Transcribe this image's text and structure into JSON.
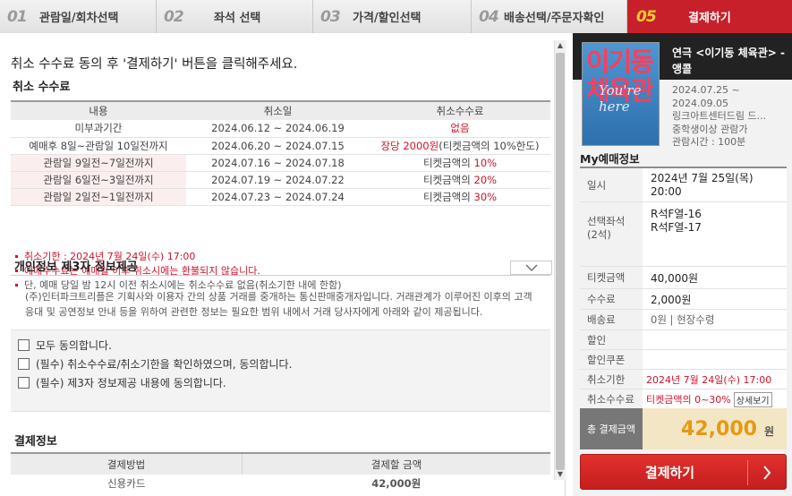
{
  "steps": [
    {
      "num": "01",
      "label": "관람일/회차선택"
    },
    {
      "num": "02",
      "label": "좌석 선택"
    },
    {
      "num": "03",
      "label": "가격/할인선택"
    },
    {
      "num": "04",
      "label": "배송선택/주문자확인"
    },
    {
      "num": "05",
      "label": "결제하기"
    }
  ],
  "instruction": "취소 수수료 동의 후 '결제하기' 버튼을 클릭해주세요.",
  "cancel_fee": {
    "title": "취소 수수료",
    "headers": [
      "내용",
      "취소일",
      "취소수수료"
    ],
    "rows": [
      {
        "content": "미부과기간",
        "date": "2024.06.12 ~ 2024.06.19",
        "fee_red": "없음",
        "fee_rest": ""
      },
      {
        "content": "예매후 8일~관람일 10일전까지",
        "date": "2024.06.20 ~ 2024.07.15",
        "fee_red": "장당 2000원",
        "fee_rest": "(티켓금액의 10%한도)"
      },
      {
        "content": "관람일 9일전~7일전까지",
        "date": "2024.07.16 ~ 2024.07.18",
        "fee_prefix": "티켓금액의 ",
        "fee_red": "10%"
      },
      {
        "content": "관람일 6일전~3일전까지",
        "date": "2024.07.19 ~ 2024.07.22",
        "fee_prefix": "티켓금액의 ",
        "fee_red": "20%"
      },
      {
        "content": "관람일 2일전~1일전까지",
        "date": "2024.07.23 ~ 2024.07.24",
        "fee_prefix": "티켓금액의 ",
        "fee_red": "30%"
      }
    ],
    "notes": [
      "취소기한 : 2024년 7월 24일(수) 17:00",
      "예매수수료는 예매일 이후 취소시에는 환불되지 않습니다.",
      "단, 예매 당일 밤 12시 이전 취소시에는 취소수수료 없음(취소기한 내에 한함)"
    ]
  },
  "privacy": {
    "title": "개인정보 제3자 정보제공",
    "text": "(주)인터파크트리플은 기획사와 이용자 간의 상품 거래를 중개하는 통신판매중개자입니다. 거래관계가 이루어진 이후의 고객응대 및 공연정보 안내 등을 위하여 관련한 정보는 필요한 범위 내에서 거래 당사자에게 아래와 같이 제공됩니다."
  },
  "agreements": [
    "모두 동의합니다.",
    "(필수) 취소수수료/취소기한을 확인하였으며, 동의합니다.",
    "(필수) 제3자 정보제공 내용에 동의합니다."
  ],
  "payment_info": {
    "title": "결제정보",
    "headers": [
      "결제방법",
      "결제할 금액"
    ],
    "method": "신용카드",
    "amount": "42,000원"
  },
  "show": {
    "poster_line1": "이기동",
    "poster_line2": "체육관",
    "title": "연극 <이기동 체육관> - 앵콜",
    "meta": [
      "2024.07.25 ~",
      "2024.09.05",
      "링크아트센터드림 드...",
      "중학생이상 관람가",
      "관람시간 : 100분"
    ]
  },
  "my_booking": {
    "title": "My예매정보",
    "date_label": "일시",
    "date_value": "2024년 7월 25일(목) 20:00",
    "seat_label": "선택좌석",
    "seat_count": "(2석)",
    "seats": [
      "R석F열-16",
      "R석F열-17"
    ],
    "price_label": "티켓금액",
    "price_value": "40,000원",
    "fee_label": "수수료",
    "fee_value": "2,000원",
    "delivery_label": "배송료",
    "delivery_value": "0원 | 현장수령",
    "discount_label": "할인",
    "coupon_label": "할인쿠폰",
    "deadline_label": "취소기한",
    "deadline_value": "2024년 7월 24일(수) 17:00",
    "cancel_fee_label": "취소수수료",
    "cancel_fee_value": "티켓금액의 0~30%",
    "detail_button": "상세보기",
    "total_label": "총 결제금액",
    "total_value": "42,000",
    "total_unit": "원",
    "pay_button": "결제하기"
  },
  "colors": {
    "accent": "#c8202a",
    "step_active_num": "#ffcc33",
    "total_amount": "#e49a14"
  }
}
